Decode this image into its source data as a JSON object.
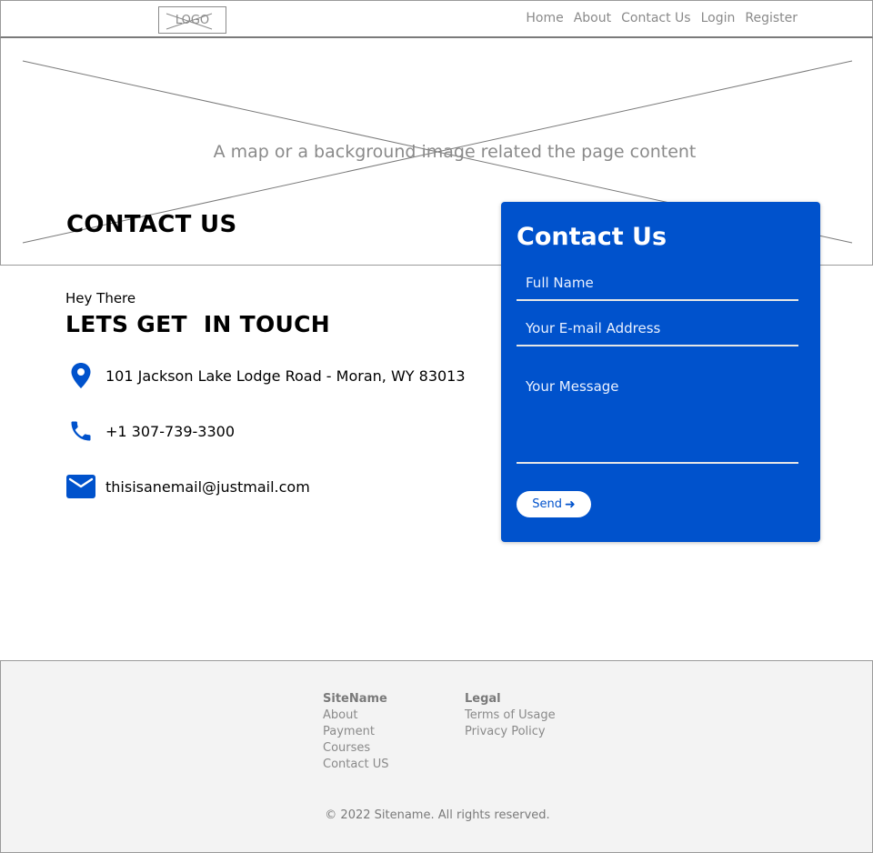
{
  "header": {
    "logo_text": "LOGO",
    "nav": [
      "Home",
      "About",
      "Contact Us",
      "Login",
      "Register"
    ]
  },
  "hero": {
    "caption": "A map or a background image related the page content",
    "title": "CONTACT US"
  },
  "info": {
    "greeting": "Hey There",
    "headline": "LETS GET  IN TOUCH",
    "address": "101 Jackson Lake Lodge Road - Moran, WY 83013",
    "phone": "+1 307-739-3300",
    "email": "thisisanemail@justmail.com",
    "icons": [
      "location-pin-icon",
      "phone-icon",
      "mail-icon"
    ],
    "icon_color": "#0052cc"
  },
  "form": {
    "title": "Contact Us",
    "name_placeholder": "Full Name",
    "email_placeholder": "Your E-mail Address",
    "message_placeholder": "Your Message",
    "send_label": "Send",
    "send_icon": "arrow-right-icon",
    "accent": "#0052cc"
  },
  "footer": {
    "col1": {
      "heading": "SiteName",
      "links": [
        "About",
        "Payment",
        "Courses",
        "Contact US"
      ]
    },
    "col2": {
      "heading": "Legal",
      "links": [
        "Terms of Usage",
        "Privacy Policy"
      ]
    },
    "copyright": "© 2022 Sitename. All rights reserved."
  }
}
